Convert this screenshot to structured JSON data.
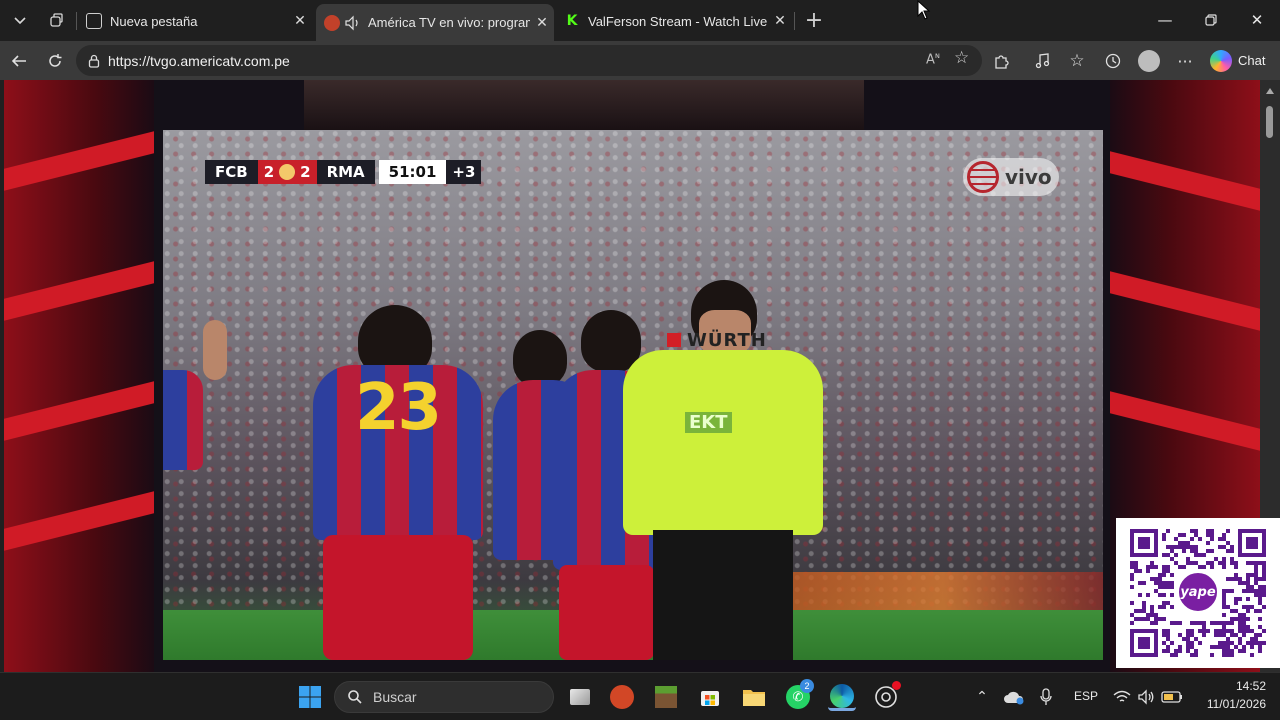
{
  "tabs": [
    {
      "title": "Nueva pestaña",
      "active": false,
      "favicon": "new-tab-page-icon"
    },
    {
      "title": "América TV en vivo: programa",
      "active": true,
      "favicon": "america-tv-icon",
      "audio": "speaker-icon"
    },
    {
      "title": "ValFerson Stream - Watch Live on",
      "active": false,
      "favicon": "kick-icon"
    }
  ],
  "toolbar": {
    "url": "https://tvgo.americatv.com.pe",
    "chat_label": "Chat"
  },
  "scoreboard": {
    "home": "FCB",
    "home_score": "2",
    "away_score": "2",
    "away": "RMA",
    "clock": "51:01",
    "added_time": "+3"
  },
  "broadcast": {
    "live_label": "vivo",
    "jersey_number": "23",
    "referee_sponsor": "WÜRTH",
    "referee_patch": "EKT"
  },
  "qr_overlay": {
    "brand": "yape"
  },
  "taskbar": {
    "search_placeholder": "Buscar",
    "whatsapp_badge": "2",
    "language": "ESP",
    "time": "14:52",
    "date": "11/01/2026"
  },
  "colors": {
    "tab_strip": "#1f1f1f",
    "toolbar": "#3a3a3a",
    "page_accent": "#d01b26",
    "scorebug_red": "#c8202a",
    "referee_shirt": "#cdf03a"
  }
}
